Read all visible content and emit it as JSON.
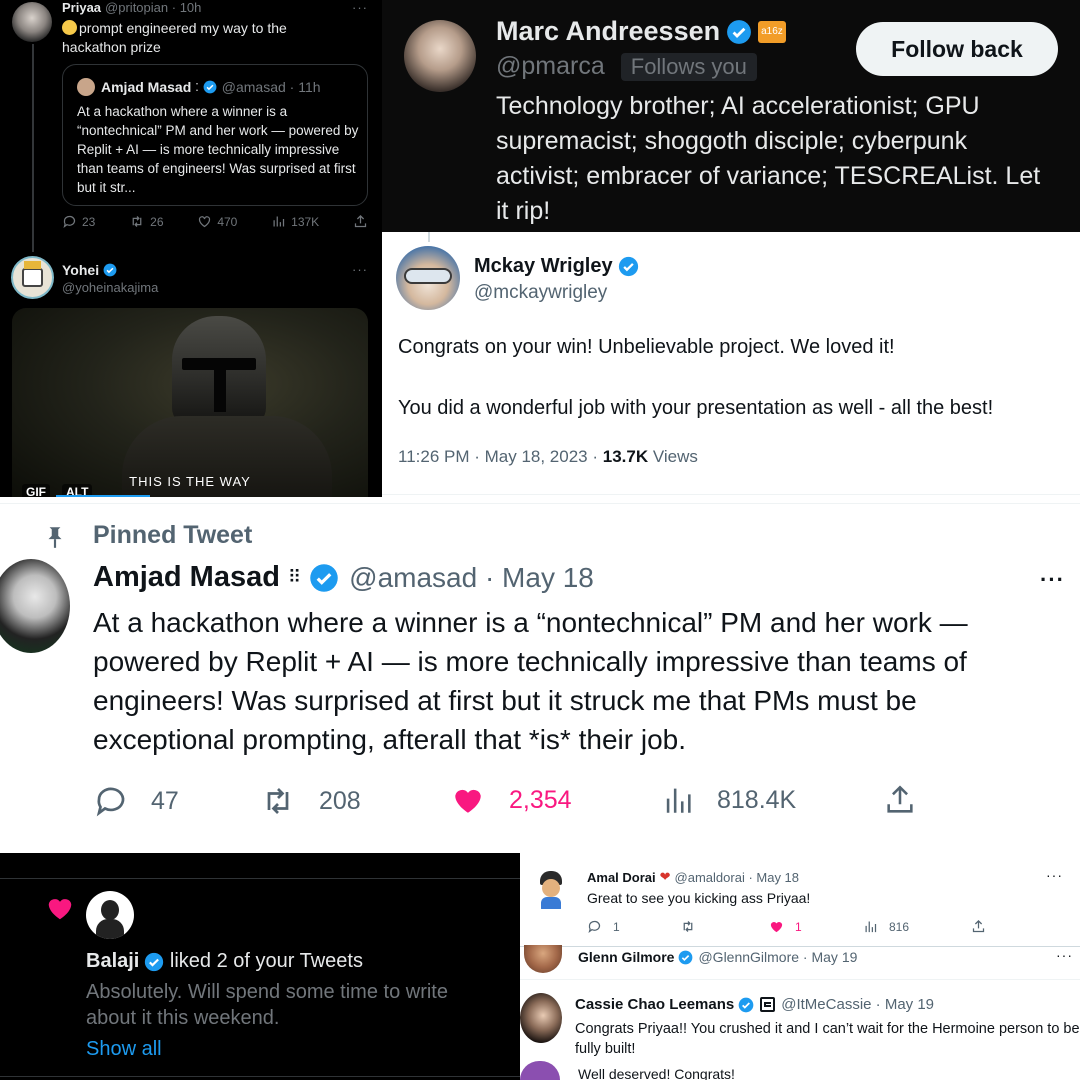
{
  "priyaa_tweet": {
    "name": "Priyaa",
    "handle": "@pritopian",
    "time": "10h",
    "text": "prompt engineered my way to the hackathon prize",
    "quote": {
      "name": "Amjad Masad",
      "handle": "@amasad",
      "time": "11h",
      "text": "At a hackathon where a winner is a “nontechnical” PM and her work — powered by Replit + AI — is more technically impressive than teams of engineers! Was surprised at first but it str..."
    },
    "stats": {
      "replies": "23",
      "retweets": "26",
      "likes": "470",
      "views": "137K"
    },
    "more": "···"
  },
  "yohei_tweet": {
    "name": "Yohei",
    "handle": "@yoheinakajima",
    "more": "···",
    "gif_caption": "THIS IS THE WAY",
    "gif_badge": "GIF",
    "alt_badge": "ALT"
  },
  "marc_profile": {
    "name": "Marc Andreessen",
    "badge": "a16z",
    "handle": "@pmarca",
    "follows_you": "Follows you",
    "follow_back": "Follow back",
    "bio": "Technology brother; AI accelerationist; GPU supremacist; shoggoth disciple; cyberpunk activist; embracer of variance; TESCREAList. Let it rip!"
  },
  "mckay_tweet": {
    "name": "Mckay Wrigley",
    "handle": "@mckaywrigley",
    "text1": "Congrats on your win! Unbelievable project. We loved it!",
    "text2": "You did a wonderful job with your presentation as well - all the best!",
    "time": "11:26 PM · May 18, 2023 · ",
    "views": "13.7K",
    "views_label": " Views"
  },
  "pinned_tweet": {
    "label": "Pinned Tweet",
    "name": "Amjad Masad",
    "handle_date": "@amasad · May 18",
    "text": "At a hackathon where a winner is a “nontechnical” PM and her work — powered by Replit + AI — is more technically impressive than teams of engineers! Was surprised at first but it struck me that PMs must be exceptional prompting, afterall that *is* their job.",
    "stats": {
      "replies": "47",
      "retweets": "208",
      "likes": "2,354",
      "views": "818.4K"
    },
    "more": "···"
  },
  "balaji_notif": {
    "name": "Balaji",
    "action": " liked 2 of your Tweets",
    "text": "Absolutely. Will spend some time to write about it this weekend.",
    "show_all": "Show all"
  },
  "amal_reply": {
    "name": "Amal Dorai",
    "handle_date": "@amaldorai · May 18",
    "text": "Great to see you kicking ass Priyaa!",
    "stats": {
      "replies": "1",
      "likes": "1",
      "views": "816"
    },
    "more": "···"
  },
  "glenn_reply": {
    "name": "Glenn Gilmore",
    "handle_date": "@GlennGilmore · May 19",
    "more": "···"
  },
  "cassie_reply": {
    "name": "Cassie Chao Leemans",
    "handle_date": "@ItMeCassie · May 19",
    "text": "Congrats Priyaa!! You crushed it and I can’t wait for the Hermoine person to be fully built!",
    "next_text": "Well deserved! Congrats!"
  },
  "colors": {
    "blue": "#1d9bf0",
    "like_pink": "#f91880",
    "dark_bg": "#000000",
    "muted_dark": "#71767b",
    "muted_light": "#536471"
  }
}
